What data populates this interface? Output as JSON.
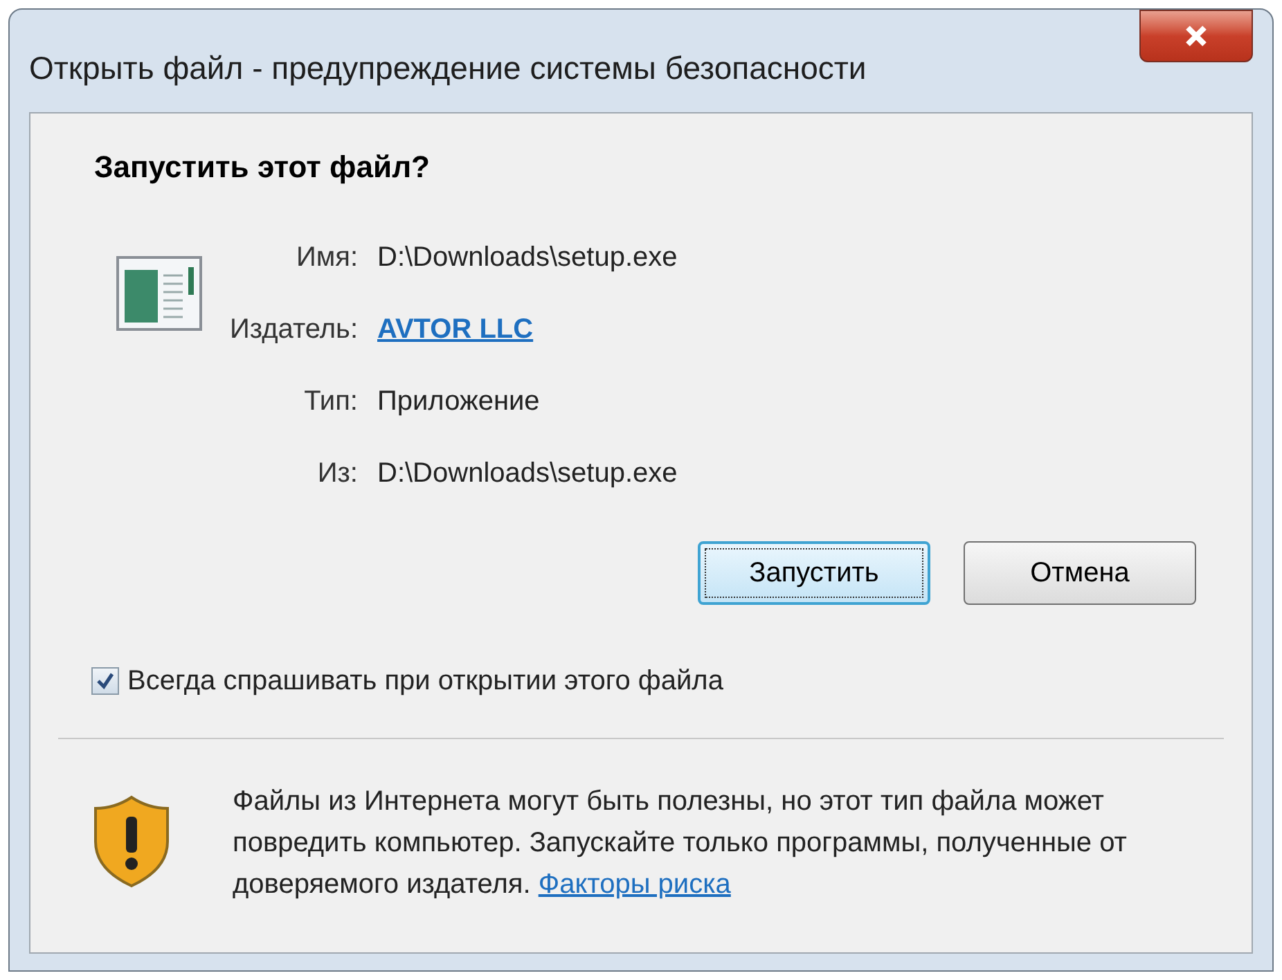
{
  "window": {
    "title": "Открыть файл - предупреждение системы безопасности"
  },
  "heading": "Запустить этот файл?",
  "fields": [
    {
      "label": "Имя:",
      "value": "D:\\Downloads\\setup.exe",
      "kind": "text"
    },
    {
      "label": "Издатель:",
      "value": "AVTOR LLC",
      "kind": "link"
    },
    {
      "label": "Тип:",
      "value": "Приложение",
      "kind": "text"
    },
    {
      "label": "Из:",
      "value": "D:\\Downloads\\setup.exe",
      "kind": "text"
    }
  ],
  "buttons": [
    {
      "label": "Запустить",
      "focused": true
    },
    {
      "label": "Отмена",
      "focused": false
    }
  ],
  "always_ask": {
    "label": "Всегда спрашивать при открытии этого файла",
    "checked": true
  },
  "warning": {
    "text": "Файлы из Интернета могут быть полезны, но этот тип файла может повредить компьютер. Запускайте только программы, полученные от доверяемого издателя.",
    "link": "Факторы риска"
  }
}
